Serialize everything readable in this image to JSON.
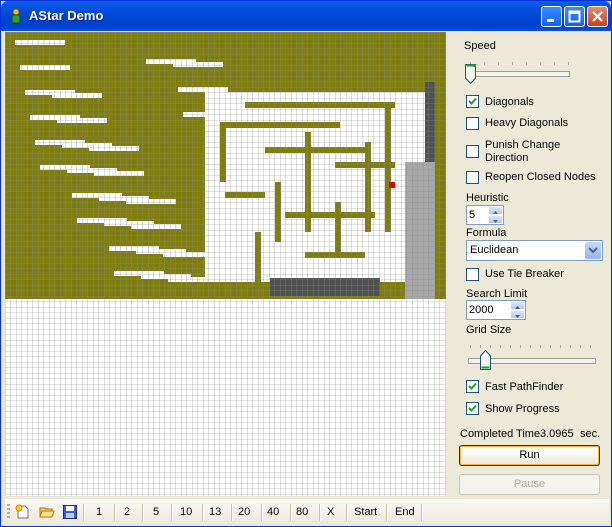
{
  "window": {
    "title": "AStar Demo"
  },
  "colors": {
    "wall": "#7e7e10",
    "open": "#ffffff",
    "visited": "#a8a8a8",
    "dark": "#505050",
    "target": "#e00000"
  },
  "panel": {
    "speed_label": "Speed",
    "diagonals_label": "Diagonals",
    "heavy_diagonals_label": "Heavy Diagonals",
    "punish_change_direction_label_line1": "Punish Change",
    "punish_change_direction_label_line2": "Direction",
    "reopen_closed_nodes_label": "Reopen Closed Nodes",
    "heuristic_label": "Heuristic",
    "heuristic_value": "5",
    "formula_label": "Formula",
    "formula_value": "Euclidean",
    "use_tie_breaker_label": "Use Tie Breaker",
    "search_limit_label": "Search Limit",
    "search_limit_value": "2000",
    "grid_size_label": "Grid Size",
    "fast_pathfinder_label": "Fast PathFinder",
    "show_progress_label": "Show Progress",
    "completed_time_label": "Completed Time",
    "completed_time_value": "3.0965",
    "completed_time_unit": "sec.",
    "run_label": "Run",
    "pause_label": "Pause"
  },
  "toolbar": {
    "items": [
      "1",
      "2",
      "5",
      "10",
      "13",
      "20",
      "40",
      "80",
      "X",
      "Start",
      "End"
    ]
  }
}
